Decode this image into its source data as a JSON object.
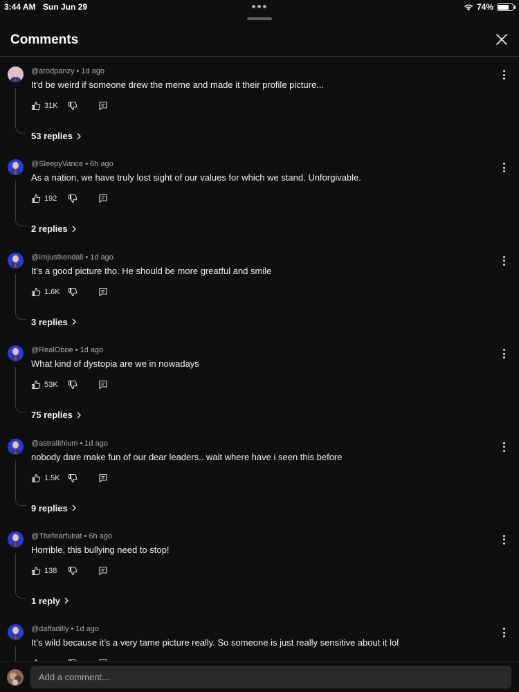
{
  "status_bar": {
    "time": "3:44 AM",
    "date": "Sun Jun 29",
    "battery": "74%",
    "battery_level": 0.74
  },
  "header": {
    "title": "Comments",
    "close_icon": "close-icon"
  },
  "comments": [
    {
      "author": "@arodpanzy",
      "age": "1d ago",
      "text": "It'd be weird if someone drew the meme and made it their profile picture...",
      "likes": "31K",
      "replies_label": "53 replies",
      "avatar_color": "#d9c0d8"
    },
    {
      "author": "@SleepyVance",
      "age": "6h ago",
      "text": "As a nation, we have truly lost sight of our values for which we stand. Unforgivable.",
      "likes": "192",
      "replies_label": "2 replies",
      "avatar_color": "#2a3bd6"
    },
    {
      "author": "@Imjustkendall",
      "age": "1d ago",
      "text": "It’s a good picture tho. He should be more greatful and smile",
      "likes": "1.6K",
      "replies_label": "3 replies",
      "avatar_color": "#2a3bd6"
    },
    {
      "author": "@RealOboe",
      "age": "1d ago",
      "text": "What kind of dystopia are we in nowadays",
      "likes": "53K",
      "replies_label": "75 replies",
      "avatar_color": "#2a3bd6"
    },
    {
      "author": "@astralithium",
      "age": "1d ago",
      "text": "nobody dare make fun of our dear leaders.. wait where have i seen this before",
      "likes": "1.5K",
      "replies_label": "9 replies",
      "avatar_color": "#2a3bd6"
    },
    {
      "author": "@Thefearfulrat",
      "age": "6h ago",
      "text": "Horrible, this bullying need to stop!",
      "likes": "138",
      "replies_label": "1 reply",
      "avatar_color": "#2a3bd6"
    },
    {
      "author": "@daffadilly",
      "age": "1d ago",
      "text": "It’s wild because it’s a very tame picture really. So someone is just really sensitive about it lol",
      "likes": "",
      "replies_label": "",
      "avatar_color": "#2a3bd6"
    }
  ],
  "footer": {
    "input_placeholder": "Add a comment..."
  },
  "colors": {
    "background": "#0f0f0f",
    "text": "#f1f1f1",
    "secondary_text": "#aaaaaa",
    "input_bg": "#2a2a2a"
  }
}
